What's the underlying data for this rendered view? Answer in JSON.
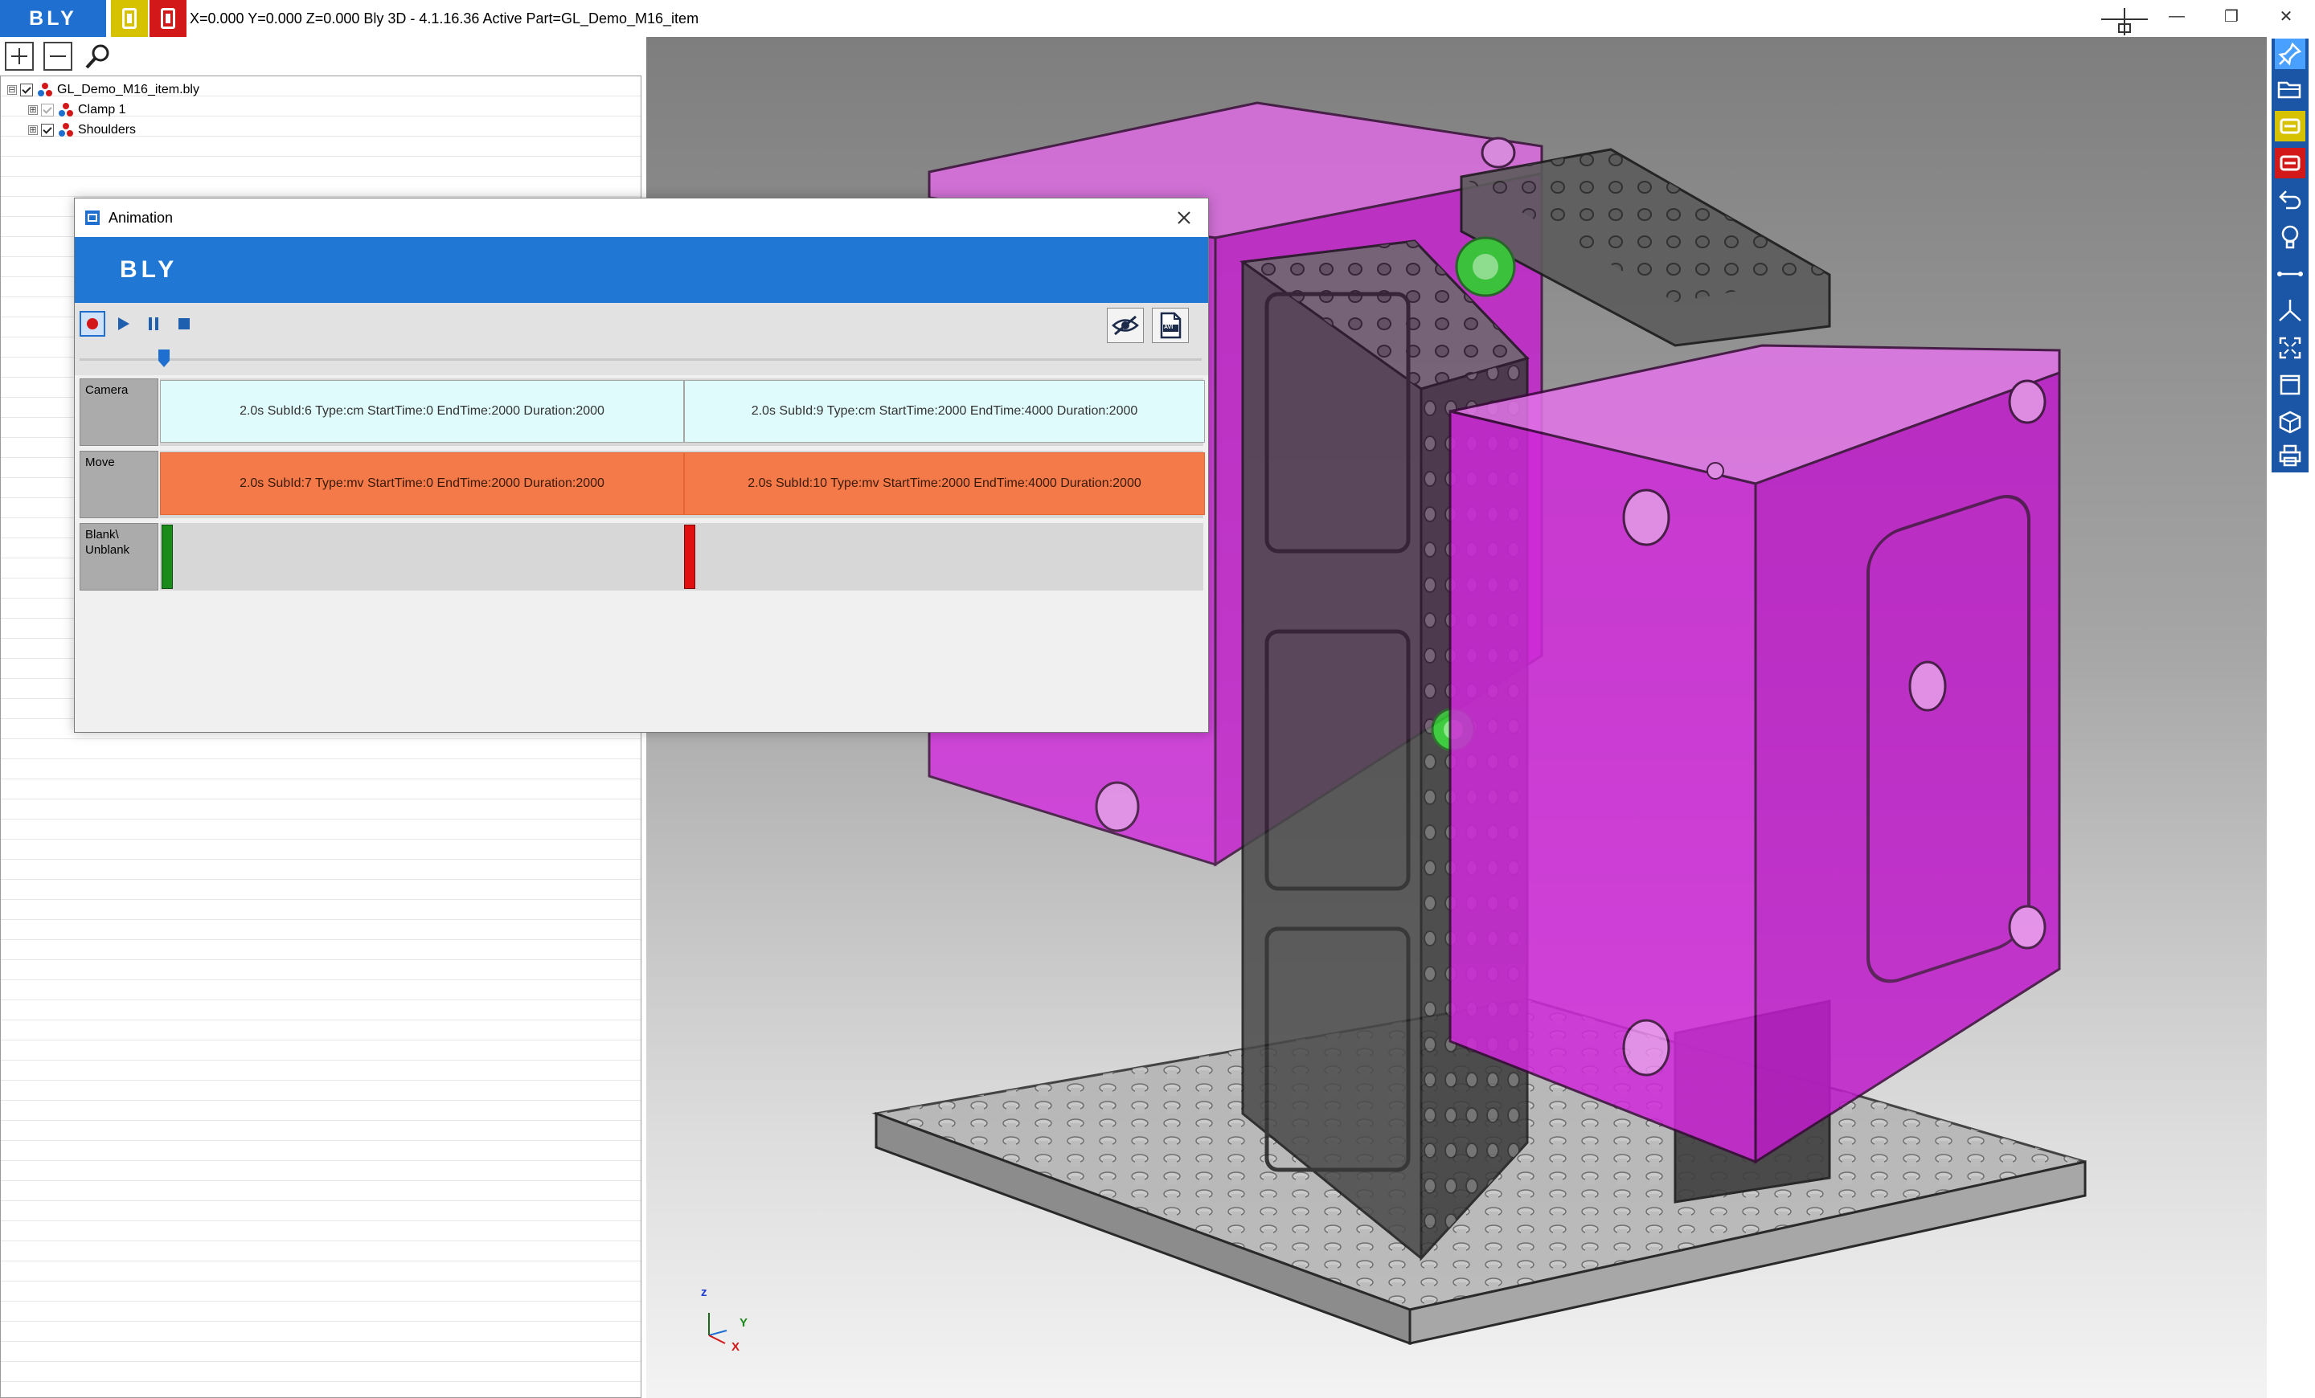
{
  "app": {
    "logo": "BLY",
    "title": "X=0.000 Y=0.000 Z=0.000   Bly 3D - 4.1.16.36 Active Part=GL_Demo_M16_item",
    "icons": [
      "yellow-part-icon",
      "red-part-icon"
    ],
    "colors": {
      "brand_blue": "#1f6fd0",
      "yellow": "#d6c200",
      "red": "#d21818"
    }
  },
  "window_controls": {
    "minimize": "—",
    "restore": "❐",
    "close": "✕"
  },
  "toolbar": {
    "expand_icon": "plus-icon",
    "collapse_icon": "minus-icon",
    "search_icon": "magnifier-icon"
  },
  "tree": {
    "items": [
      {
        "label": "GL_Demo_M16_item.bly",
        "expander": "⊟",
        "checked": true
      },
      {
        "label": "Clamp 1",
        "expander": "⊞",
        "checked": true
      },
      {
        "label": "Shoulders",
        "expander": "⊞",
        "checked": true
      }
    ]
  },
  "right_toolbar": {
    "icons": [
      "pin-icon",
      "folder-open-icon",
      "yellow-part-icon",
      "red-part-icon",
      "undo-arrow-icon",
      "lightbulb-icon",
      "measure-line-icon",
      "axis-triad-icon",
      "fit-extents-icon",
      "view-window-icon",
      "iso-cube-icon",
      "print-icon"
    ]
  },
  "animation_dialog": {
    "title": "Animation",
    "banner_logo": "BLY",
    "controls": [
      "record-icon",
      "play-icon",
      "pause-icon",
      "stop-icon"
    ],
    "right_controls": [
      "hide-eye-icon",
      "avi-export-icon"
    ],
    "avi_label": "AVI",
    "slider_position": 0.07,
    "tracks": [
      {
        "label": "Camera",
        "clips": [
          "2.0s SubId:6 Type:cm StartTime:0 EndTime:2000 Duration:2000",
          "2.0s SubId:9 Type:cm StartTime:2000 EndTime:4000 Duration:2000"
        ]
      },
      {
        "label": "Move",
        "clips": [
          "2.0s SubId:7 Type:mv StartTime:0 EndTime:2000 Duration:2000",
          "2.0s SubId:10 Type:mv StartTime:2000 EndTime:4000 Duration:2000"
        ]
      },
      {
        "label_line1": "Blank\\",
        "label_line2": "Unblank",
        "markers": [
          "blank-marker-green",
          "unblank-marker-red"
        ]
      }
    ],
    "colors": {
      "camera_clip": "#e0fbfc",
      "move_clip": "#f47a4a",
      "blank": "#1a8a1a",
      "unblank": "#e01010"
    }
  },
  "axis_triad": {
    "z": "z",
    "y": "Y",
    "x": "X"
  },
  "viewport": {
    "model_colors": {
      "part": "#e035e6",
      "fixture": "#3a3a3a",
      "base": "#9a9a9a",
      "pins": "#2ed12e"
    }
  }
}
